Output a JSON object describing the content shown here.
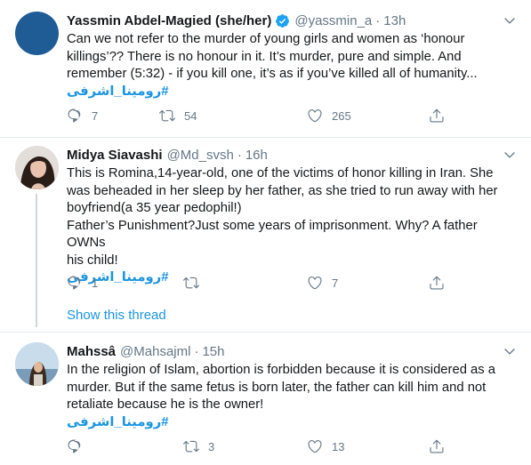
{
  "tweets": [
    {
      "name": "Yassmin Abdel-Magied (she/her)",
      "handle": "@yassmin_a",
      "time": "13h",
      "verified": true,
      "text_lines": [
        "Can we not refer to the murder of young girls and women as ‘honour",
        "killings’?? There is no honour in it. It’s murder, pure and simple. And",
        "remember (5:32) - if you kill one, it’s as if you’ve killed all of humanity..."
      ],
      "hashtag": "#رومینا_اشرفی",
      "replies": "7",
      "retweets": "54",
      "likes": "265"
    },
    {
      "name": "Midya Siavashi",
      "handle": "@Md_svsh",
      "time": "16h",
      "verified": false,
      "text_lines": [
        "This is Romina,14-year-old, one of the victims of honor killing in Iran. She",
        "was beheaded in her sleep by her father, as she tried to run away with her",
        "boyfriend(a 35 year pedophil!)",
        "Father’s Punishment?Just some years of imprisonment. Why? A father OWNs",
        "his child!"
      ],
      "hashtag": "#رومینا_اشرفی",
      "replies": "1",
      "retweets": "",
      "likes": "7",
      "show_thread": "Show this thread"
    },
    {
      "name": "Mahssâ",
      "handle": "@Mahsajml",
      "time": "15h",
      "verified": false,
      "text_lines": [
        "In the religion of Islam, abortion is forbidden because it is considered as a",
        "murder. But if the same fetus is born later, the father can kill him and not",
        "retaliate because he is the owner!"
      ],
      "hashtag": "#رومینا_اشرفی",
      "replies": "",
      "retweets": "3",
      "likes": "13"
    }
  ],
  "separator": "·",
  "colors": {
    "accent": "#1b95e0",
    "muted": "#657786",
    "divider": "#e6ecf0",
    "avatar1": "#1f5c96"
  },
  "icons": {
    "reply": "reply-icon",
    "retweet": "retweet-icon",
    "like": "like-icon",
    "share": "share-icon",
    "caret": "chevron-down-icon",
    "verified": "verified-badge-icon"
  }
}
